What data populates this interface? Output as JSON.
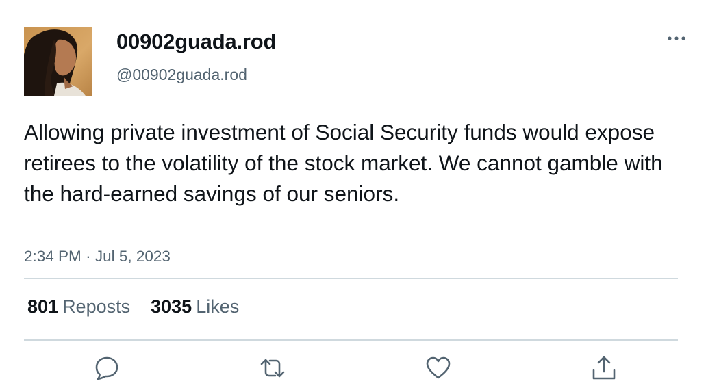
{
  "user": {
    "display_name": "00902guada.rod",
    "handle": "@00902guada.rod"
  },
  "post": {
    "text": "Allowing private investment of Social Security funds would expose retirees to the volatility of the stock market. We cannot gamble with the hard-earned savings of our seniors.",
    "time": "2:34 PM",
    "separator": "·",
    "date": "Jul 5, 2023"
  },
  "stats": {
    "reposts_count": "801",
    "reposts_label": "Reposts",
    "likes_count": "3035",
    "likes_label": "Likes"
  },
  "icons": {
    "more": "more-horizontal-icon",
    "reply": "reply-icon",
    "repost": "repost-icon",
    "like": "heart-icon",
    "share": "share-icon"
  },
  "colors": {
    "text_primary": "#0f1419",
    "text_secondary": "#536471",
    "divider": "#cfd9de"
  }
}
